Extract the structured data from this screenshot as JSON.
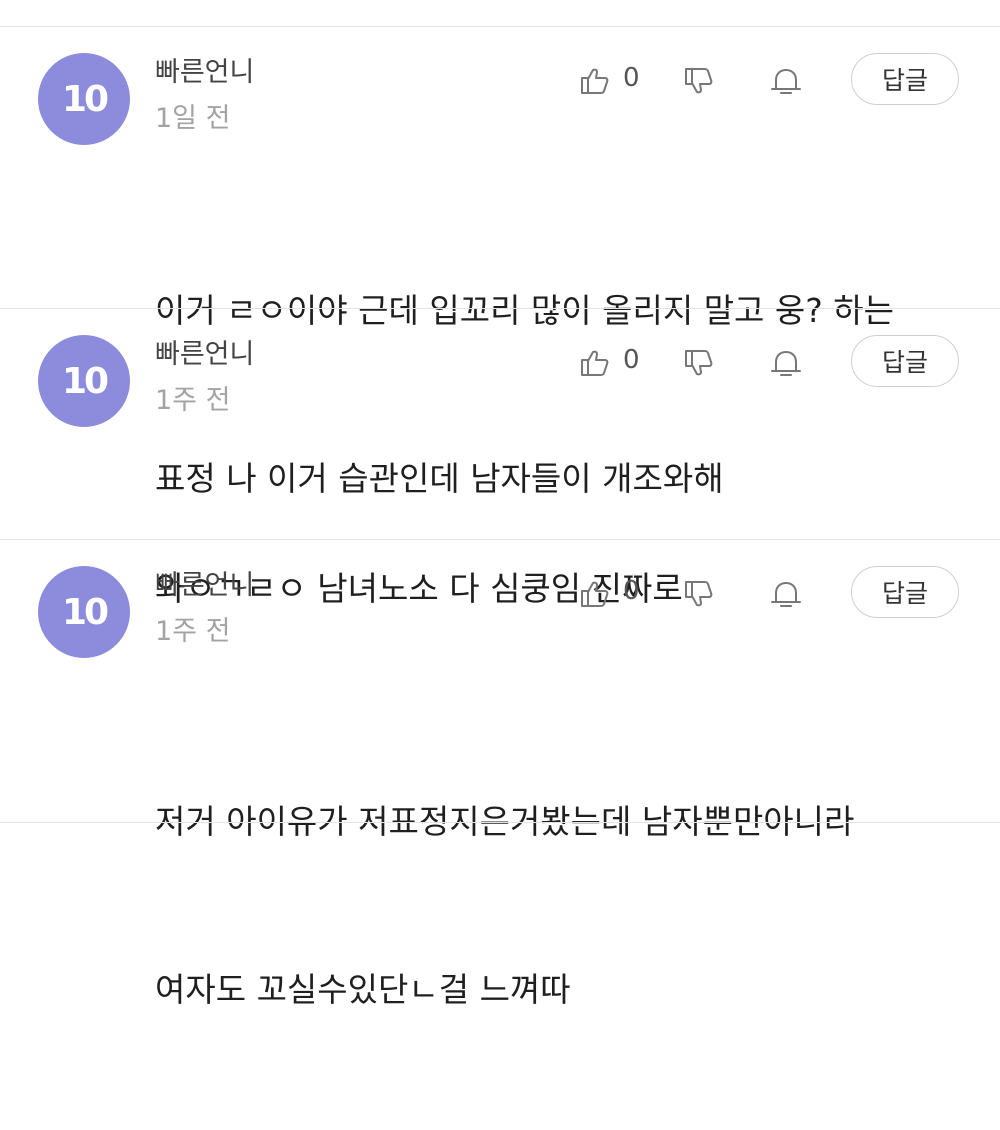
{
  "comments": [
    {
      "avatar_text": "10",
      "author": "빠른언니",
      "time": "1일 전",
      "like_count": "0",
      "reply_label": "답글",
      "body_lines": [
        "이거 ㄹㅇ이야 근데 입꼬리 많이 올리지 말고 웅? 하는",
        "표정 나 이거 습관인데 남자들이 개조와해"
      ]
    },
    {
      "avatar_text": "10",
      "author": "빠른언니",
      "time": "1주 전",
      "like_count": "0",
      "reply_label": "답글",
      "body_lines": [
        "와ㅇㄱㄹㅇ 남녀노소 다 심쿵임 진짜로"
      ]
    },
    {
      "avatar_text": "10",
      "author": "빠른언니",
      "time": "1주 전",
      "like_count": "0",
      "reply_label": "답글",
      "body_lines": [
        "저거 아이유가 저표정지은거봤는데 남자뿐만아니라",
        "여자도 꼬실수있단ㄴ걸 느껴따"
      ]
    }
  ],
  "icons": {
    "like": "thumbs-up-icon",
    "dislike": "thumbs-down-icon",
    "notify": "bell-icon"
  },
  "colors": {
    "avatar": "#8d8bdb",
    "divider": "#e3e3e3",
    "muted_text": "#a3a3a3"
  }
}
